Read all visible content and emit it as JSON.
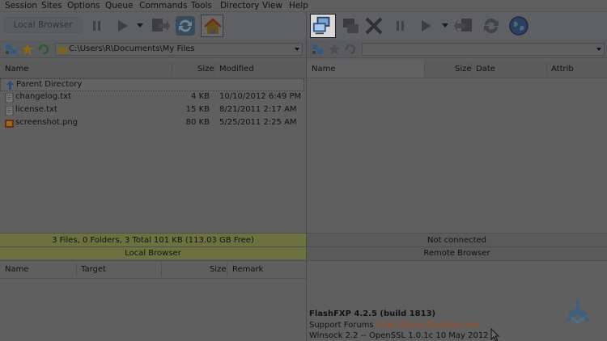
{
  "menu": [
    "Session",
    "Sites",
    "Options",
    "Queue",
    "Commands",
    "Tools",
    "Directory",
    "View",
    "Help"
  ],
  "toolbar_left": {
    "local_browser_label": "Local Browser",
    "icons": [
      "pause-icon",
      "play-icon",
      "transfer-icon",
      "refresh-icon",
      "home-icon"
    ]
  },
  "toolbar_right": {
    "icons": [
      "connect-icon",
      "disconnect-icon",
      "abort-icon",
      "pause-icon",
      "play-icon",
      "transfer-icon",
      "refresh-icon",
      "globe-icon"
    ]
  },
  "left_browser": {
    "path": "C:\\Users\\R\\Documents\\My Files",
    "columns": {
      "name": "Name",
      "size": "Size",
      "modified": "Modified"
    },
    "files": [
      {
        "name": "Parent Directory",
        "size": "",
        "modified": "",
        "icon": "parent-dir-icon"
      },
      {
        "name": "changelog.txt",
        "size": "4 KB",
        "modified": "10/10/2012 6:49 PM",
        "icon": "text-file-icon"
      },
      {
        "name": "license.txt",
        "size": "15 KB",
        "modified": "8/21/2011 2:17 AM",
        "icon": "text-file-icon"
      },
      {
        "name": "screenshot.png",
        "size": "80 KB",
        "modified": "5/25/2011 2:25 AM",
        "icon": "image-file-icon"
      }
    ],
    "status_line": "3 Files, 0 Folders, 3 Total 101 KB (113.03 GB Free)",
    "status_label": "Local Browser"
  },
  "right_browser": {
    "path": "",
    "columns": {
      "name": "Name",
      "size": "Size",
      "date": "Date",
      "attrib": "Attrib"
    },
    "status_line": "Not connected",
    "status_label": "Remote Browser"
  },
  "queue": {
    "columns": {
      "name": "Name",
      "target": "Target",
      "size": "Size",
      "remark": "Remark"
    }
  },
  "log": {
    "app_version": "FlashFXP 4.2.5 (build 1813)",
    "forums_label": "Support Forums",
    "forums_link": "http://forum.flashfxp.com",
    "ssl_line": "Winsock 2.2 -- OpenSSL 1.0.1c 10 May 2012"
  },
  "colors": {
    "accent_green": "#6b7240",
    "link": "#a8491b",
    "highlight": "#ffffff"
  }
}
